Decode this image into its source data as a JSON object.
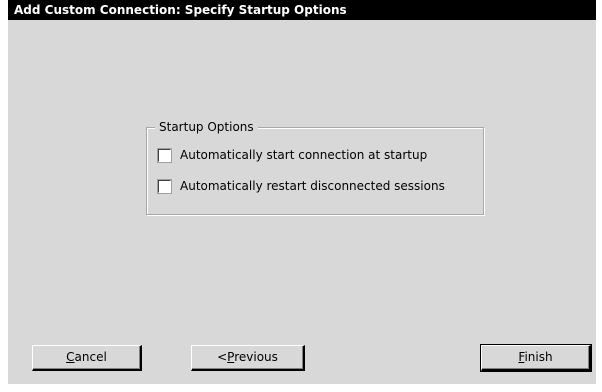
{
  "window": {
    "title": "Add Custom Connection: Specify Startup Options"
  },
  "startup_options": {
    "legend": "Startup Options",
    "options": [
      {
        "label": "Automatically start connection at startup",
        "checked": false
      },
      {
        "label": "Automatically restart disconnected sessions",
        "checked": false
      }
    ]
  },
  "buttons": {
    "cancel": {
      "label": "Cancel",
      "mnemonic": "C"
    },
    "previous": {
      "label": "<Previous",
      "mnemonic": "P"
    },
    "finish": {
      "label": "Finish",
      "mnemonic": "F"
    }
  }
}
